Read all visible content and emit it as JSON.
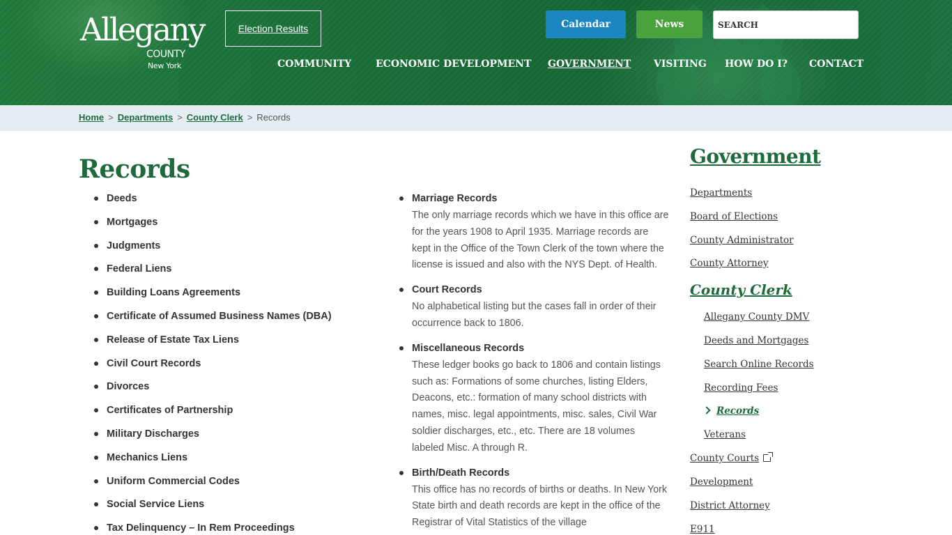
{
  "header": {
    "logo": {
      "main": "Allegany",
      "county": "COUNTY",
      "state": "New York"
    },
    "election_results": "Election Results",
    "calendar": "Calendar",
    "news": "News",
    "search_placeholder": "SEARCH",
    "nav": [
      {
        "label": "COMMUNITY"
      },
      {
        "label": "ECONOMIC DEVELOPMENT"
      },
      {
        "label": "GOVERNMENT"
      },
      {
        "label": "VISITING"
      },
      {
        "label": "HOW DO I?"
      },
      {
        "label": "CONTACT"
      }
    ],
    "active_nav": "GOVERNMENT"
  },
  "breadcrumb": {
    "links": [
      "Home",
      "Departments",
      "County Clerk"
    ],
    "current": "Records",
    "separator": ">"
  },
  "page_title": "Records",
  "left_list": [
    "Deeds",
    "Mortgages",
    "Judgments",
    "Federal Liens",
    "Building Loans Agreements",
    "Certificate of Assumed Business Names (DBA)",
    "Release of Estate Tax Liens",
    "Civil Court Records",
    "Divorces",
    "Certificates of Partnership",
    "Military Discharges",
    "Mechanics Liens",
    "Uniform Commercial Codes",
    "Social Service Liens",
    "Tax Delinquency – In Rem Proceedings"
  ],
  "mid_list": [
    {
      "title": "Marriage Records",
      "body": "The only marriage records which we have in this office are for the years 1908 to April 1935. Marriage records are kept in the Office of the Town Clerk of the town where the license is issued and also with the NYS Dept. of Health."
    },
    {
      "title": "Court Records",
      "body": "No alphabetical listing but the cases fall in order of their occurrence back to 1806."
    },
    {
      "title": "Miscellaneous Records",
      "body": "These ledger books go back to 1806 and contain listings such as: Formations of some churches, listing Elders, Deacons, etc.: formation of many school districts with names, misc. legal appointments, misc. sales, Civil War soldier discharges, etc., etc. There are 18 volumes labeled Misc. A through R."
    },
    {
      "title": "Birth/Death Records",
      "body": "This office has no records of births or deaths. In New York State birth and death records are kept in the office of the Registrar of Vital Statistics of the village"
    }
  ],
  "sidebar": {
    "title": "Government",
    "top_links_before": [
      "Departments",
      "Board of Elections",
      "County Administrator",
      "County Attorney"
    ],
    "section": "County Clerk",
    "sub_links_before": [
      "Allegany County DMV",
      "Deeds and Mortgages",
      "Search Online Records",
      "Recording Fees"
    ],
    "current": "Records",
    "sub_links_after": [
      "Veterans"
    ],
    "top_links_after": [
      "County Courts",
      "Development",
      "District Attorney",
      "E911"
    ]
  },
  "colors": {
    "brand_green": "#1e6a3c",
    "calendar_blue": "#1a87c2",
    "news_green": "#4aa13e",
    "breadcrumb_bg": "#e3edf2"
  }
}
